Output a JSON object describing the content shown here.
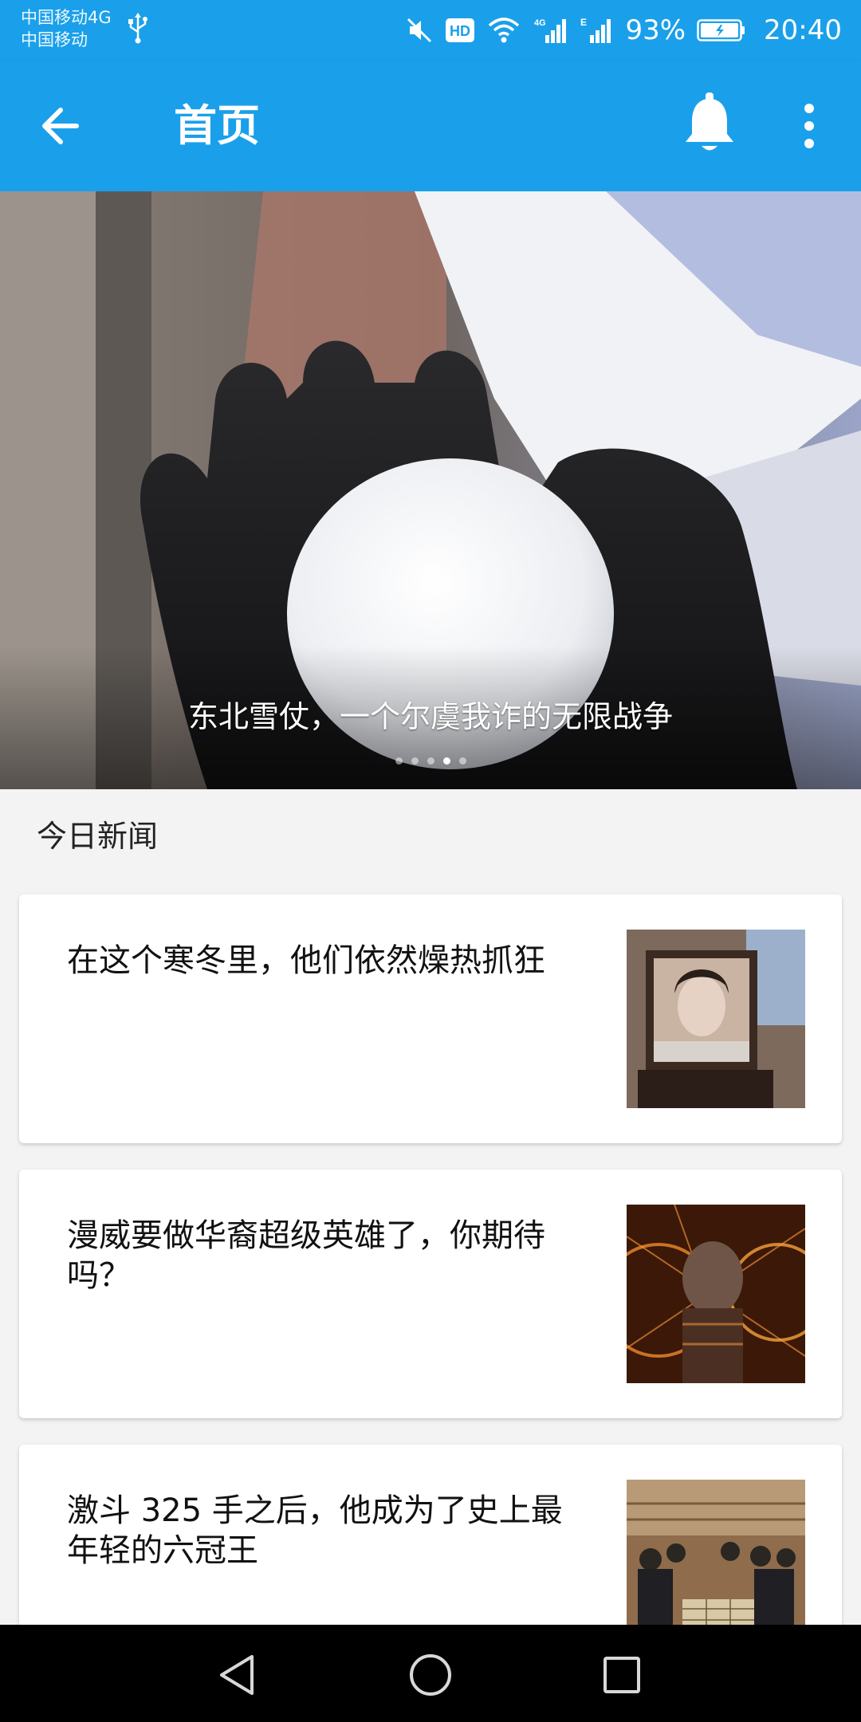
{
  "status_bar": {
    "carrier_primary": "中国移动4G",
    "carrier_secondary": "中国移动",
    "battery": "93%",
    "time": "20:40",
    "icons": [
      "usb-icon",
      "mute-icon",
      "hd-icon",
      "wifi-icon",
      "signal-4g-icon",
      "signal-e-icon",
      "battery-icon"
    ]
  },
  "app_bar": {
    "title": "首页",
    "back_icon": "arrow-left-icon",
    "notification_icon": "bell-icon",
    "menu_icon": "more-vertical-icon"
  },
  "banner": {
    "caption": "东北雪仗，一个尔虞我诈的无限战争",
    "slide_count": 5,
    "active_slide": 4
  },
  "section": {
    "title": "今日新闻"
  },
  "news": [
    {
      "title": "在这个寒冬里，他们依然燥热抓狂"
    },
    {
      "title": "漫威要做华裔超级英雄了，你期待吗？"
    },
    {
      "title": "激斗 325 手之后，他成为了史上最年轻的六冠王"
    }
  ],
  "nav_bar": {
    "icons": [
      "back-triangle-icon",
      "home-circle-icon",
      "recents-square-icon"
    ]
  },
  "colors": {
    "primary": "#1aa0ea",
    "card_bg": "#ffffff",
    "page_bg": "#f3f3f3"
  }
}
